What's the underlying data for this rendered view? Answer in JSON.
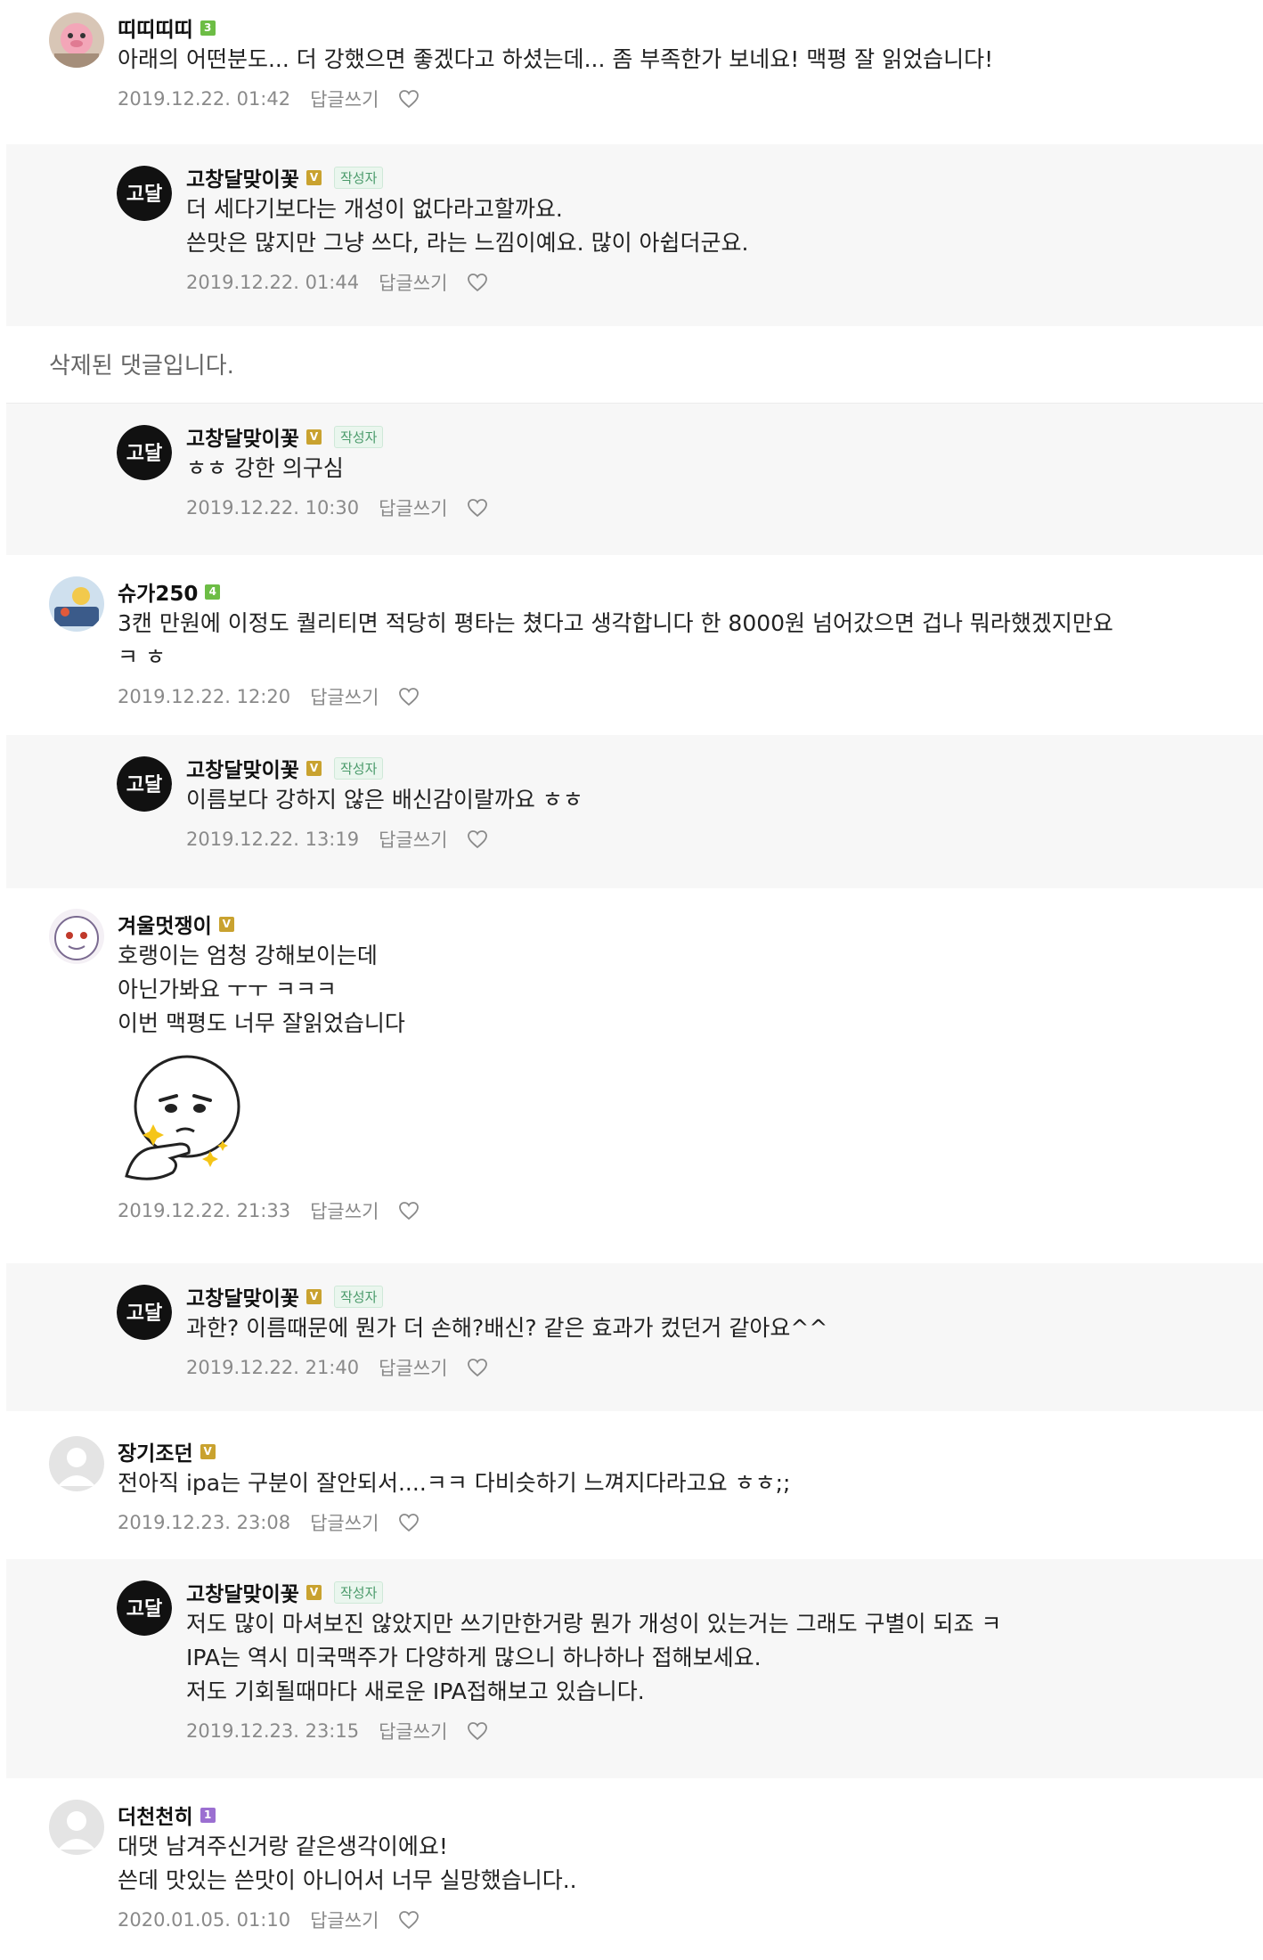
{
  "reply_label": "답글쓰기",
  "author_badge": "작성자",
  "deleted_text": "삭제된 댓글입니다.",
  "colors": {
    "level_green": "#6dbd45",
    "level_gold": "#c9a22f",
    "level_purple": "#9b6fd1",
    "author_tag_text": "#4a9a6a",
    "reply_background": "#f7f7f7",
    "meta_gray": "#8a8a8a"
  },
  "comments": [
    {
      "name": "띠띠띠띠",
      "level": "3",
      "level_color": "green",
      "lines": [
        "아래의 어떤분도... 더 강했으면 좋겠다고 하셨는데... 좀 부족한가 보네요! 맥평 잘 읽었습니다!"
      ],
      "time": "2019.12.22. 01:42"
    },
    {
      "name": "고창달맞이꽃",
      "level": "V",
      "level_color": "gold",
      "lines": [
        "더 세다기보다는 개성이 없다라고할까요.",
        "쓴맛은 많지만 그냥 쓰다, 라는 느낌이예요. 많이 아쉽더군요."
      ],
      "time": "2019.12.22. 01:44"
    },
    {
      "name": "고창달맞이꽃",
      "level": "V",
      "level_color": "gold",
      "lines": [
        "ㅎㅎ 강한 의구심"
      ],
      "time": "2019.12.22. 10:30"
    },
    {
      "name": "슈가250",
      "level": "4",
      "level_color": "green",
      "lines": [
        "3캔 만원에 이정도 퀄리티면 적당히 평타는 쳤다고 생각합니다 한 8000원 넘어갔으면 겁나 뭐라했겠지만요",
        "ㅋ ㅎ"
      ],
      "time": "2019.12.22. 12:20"
    },
    {
      "name": "고창달맞이꽃",
      "level": "V",
      "level_color": "gold",
      "lines": [
        "이름보다 강하지 않은 배신감이랄까요 ㅎㅎ"
      ],
      "time": "2019.12.22. 13:19"
    },
    {
      "name": "겨울멋쟁이",
      "level": "V",
      "level_color": "gold",
      "lines": [
        "호랭이는 엄청 강해보이는데",
        "아닌가봐요 ㅜㅜ ㅋㅋㅋ",
        "이번 맥평도 너무 잘읽었습니다"
      ],
      "time": "2019.12.22. 21:33"
    },
    {
      "name": "고창달맞이꽃",
      "level": "V",
      "level_color": "gold",
      "lines": [
        "과한? 이름때문에 뭔가 더 손해?배신? 같은 효과가 컸던거 같아요^^"
      ],
      "time": "2019.12.22. 21:40"
    },
    {
      "name": "장기조던",
      "level": "V",
      "level_color": "gold",
      "lines": [
        "전아직 ipa는 구분이 잘안되서....ㅋㅋ 다비슷하기 느껴지다라고요 ㅎㅎ;;"
      ],
      "time": "2019.12.23. 23:08"
    },
    {
      "name": "고창달맞이꽃",
      "level": "V",
      "level_color": "gold",
      "lines": [
        "저도 많이 마셔보진 않았지만 쓰기만한거랑 뭔가 개성이 있는거는 그래도 구별이 되죠 ㅋ",
        "IPA는 역시 미국맥주가 다양하게 많으니 하나하나 접해보세요.",
        "저도 기회될때마다 새로운 IPA접해보고 있습니다."
      ],
      "time": "2019.12.23. 23:15"
    },
    {
      "name": "더천천히",
      "level": "1",
      "level_color": "purple",
      "lines": [
        "대댓 남겨주신거랑 같은생각이에요!",
        "쓴데 맛있는 쓴맛이 아니어서 너무 실망했습니다.."
      ],
      "time": "2020.01.05. 01:10"
    }
  ]
}
